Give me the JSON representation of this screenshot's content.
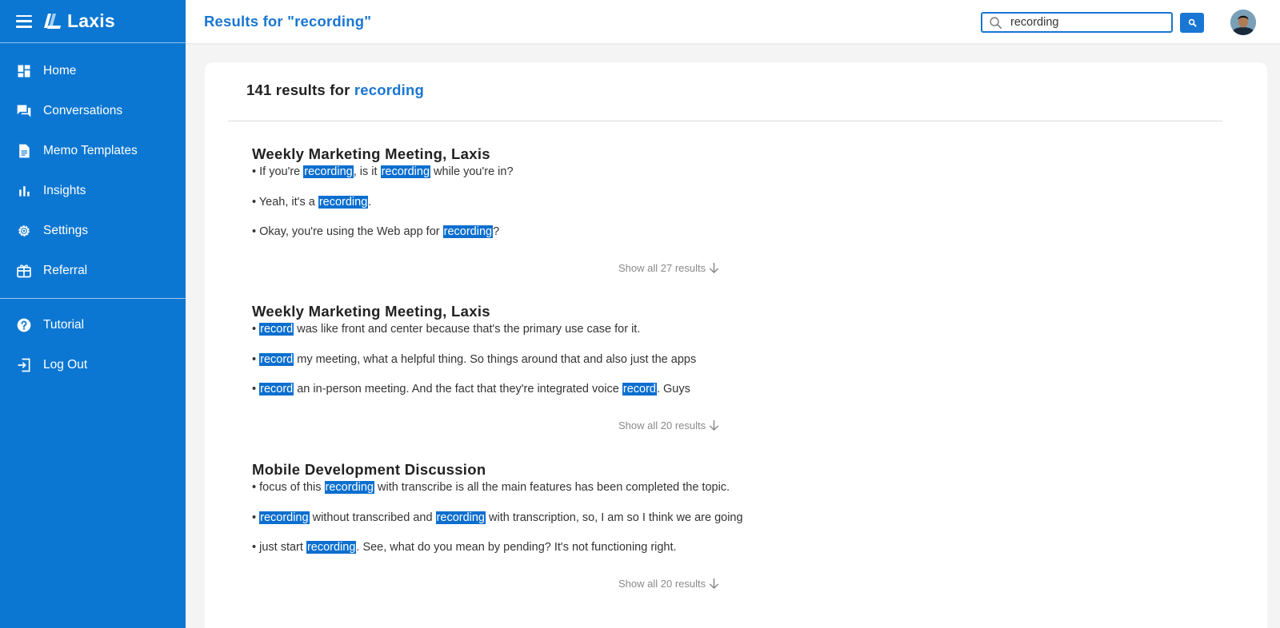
{
  "app": {
    "name": "Laxis"
  },
  "sidebar": {
    "items": [
      {
        "label": "Home",
        "icon": "dashboard-icon"
      },
      {
        "label": "Conversations",
        "icon": "chat-icon"
      },
      {
        "label": "Memo Templates",
        "icon": "document-icon"
      },
      {
        "label": "Insights",
        "icon": "bar-chart-icon"
      },
      {
        "label": "Settings",
        "icon": "gear-icon"
      },
      {
        "label": "Referral",
        "icon": "gift-icon"
      }
    ],
    "secondary_items": [
      {
        "label": "Tutorial",
        "icon": "help-icon"
      },
      {
        "label": "Log Out",
        "icon": "logout-icon"
      }
    ]
  },
  "header": {
    "title": "Results for \"recording\"",
    "search_value": "recording"
  },
  "results": {
    "count_text": "141 results for",
    "query": "recording",
    "groups": [
      {
        "title": "Weekly Marketing Meeting, Laxis",
        "snippets": [
          [
            {
              "t": "• If you're "
            },
            {
              "t": "recording",
              "hl": true
            },
            {
              "t": ", is it "
            },
            {
              "t": "recording",
              "hl": true
            },
            {
              "t": " while you're in?"
            }
          ],
          [
            {
              "t": "• Yeah, it's a "
            },
            {
              "t": "recording",
              "hl": true
            },
            {
              "t": "."
            }
          ],
          [
            {
              "t": "• Okay, you're using the Web app for "
            },
            {
              "t": "recording",
              "hl": true
            },
            {
              "t": "?"
            }
          ]
        ],
        "show_all": "Show all 27 results"
      },
      {
        "title": "Weekly Marketing Meeting, Laxis",
        "snippets": [
          [
            {
              "t": "• "
            },
            {
              "t": "record",
              "hl": true
            },
            {
              "t": " was like front and center because that's the primary use case for it."
            }
          ],
          [
            {
              "t": "• "
            },
            {
              "t": "record",
              "hl": true
            },
            {
              "t": " my meeting, what a helpful thing. So things around that and also just the apps"
            }
          ],
          [
            {
              "t": "• "
            },
            {
              "t": "record",
              "hl": true
            },
            {
              "t": " an in-person meeting. And the fact that they're integrated voice "
            },
            {
              "t": "record",
              "hl": true
            },
            {
              "t": ". Guys"
            }
          ]
        ],
        "show_all": "Show all 20 results"
      },
      {
        "title": "Mobile Development Discussion",
        "snippets": [
          [
            {
              "t": "• focus of this "
            },
            {
              "t": "recording",
              "hl": true
            },
            {
              "t": " with transcribe is all the main features has been completed the topic."
            }
          ],
          [
            {
              "t": "• "
            },
            {
              "t": "recording",
              "hl": true
            },
            {
              "t": " without transcribed and "
            },
            {
              "t": "recording",
              "hl": true
            },
            {
              "t": " with transcription, so, I am so I think we are going"
            }
          ],
          [
            {
              "t": "• just start "
            },
            {
              "t": "recording",
              "hl": true
            },
            {
              "t": ". See, what do you mean by pending? It's not functioning right."
            }
          ]
        ],
        "show_all": "Show all 20 results"
      }
    ]
  },
  "colors": {
    "brand": "#0b77d2",
    "accent": "#1976d2",
    "highlight": "#0b6fcf"
  }
}
